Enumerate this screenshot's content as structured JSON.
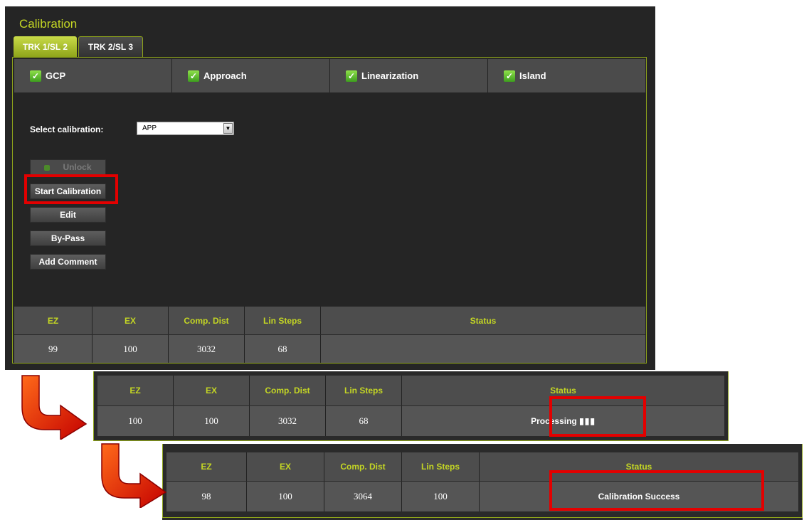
{
  "panel": {
    "title": "Calibration"
  },
  "tabs": [
    {
      "label": "TRK 1/SL 2",
      "active": true
    },
    {
      "label": "TRK 2/SL 3",
      "active": false
    }
  ],
  "calibrations": [
    {
      "label": "GCP",
      "checked": true
    },
    {
      "label": "Approach",
      "checked": true
    },
    {
      "label": "Linearization",
      "checked": true
    },
    {
      "label": "Island",
      "checked": true
    }
  ],
  "select": {
    "label": "Select calibration:",
    "value": "APP"
  },
  "buttons": {
    "unlock": "Unlock",
    "start": "Start Calibration",
    "edit": "Edit",
    "bypass": "By-Pass",
    "comment": "Add Comment"
  },
  "table": {
    "headers": [
      "EZ",
      "EX",
      "Comp. Dist",
      "Lin Steps",
      "Status"
    ],
    "row1": [
      "99",
      "100",
      "3032",
      "68",
      ""
    ],
    "row2": [
      "100",
      "100",
      "3032",
      "68",
      "Processing"
    ],
    "row3": [
      "98",
      "100",
      "3064",
      "100",
      "Calibration Success"
    ]
  },
  "colors": {
    "accent": "#c4d624",
    "highlight": "#e30000",
    "arrow": "#e02000"
  }
}
